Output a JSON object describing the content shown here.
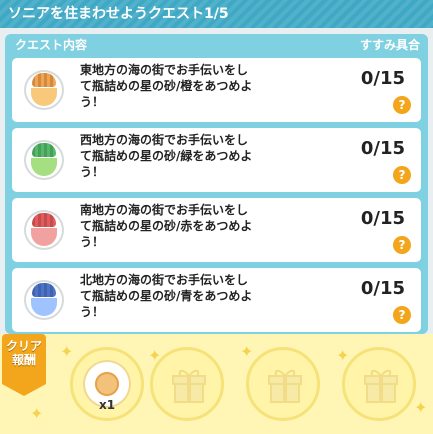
{
  "title": "ソニアを住まわせようクエスト1/5",
  "panel": {
    "header_left": "クエスト内容",
    "header_right": "すすみ具合"
  },
  "quests": [
    {
      "text": "東地方の海の街でお手伝いをし\nて瓶詰めの星の砂/橙をあつめよ\nう！",
      "progress": "0/15",
      "cap_color": "#f4a34f",
      "sand_color": "#f8c97b",
      "help": "?"
    },
    {
      "text": "西地方の海の街でお手伝いをし\nて瓶詰めの星の砂/緑をあつめよ\nう！",
      "progress": "0/15",
      "cap_color": "#55b96a",
      "sand_color": "#a6de82",
      "help": "?"
    },
    {
      "text": "南地方の海の街でお手伝いをし\nて瓶詰めの星の砂/赤をあつめよ\nう！",
      "progress": "0/15",
      "cap_color": "#e35b5b",
      "sand_color": "#f2a1a1",
      "help": "?"
    },
    {
      "text": "北地方の海の街でお手伝いをし\nて瓶詰めの星の砂/青をあつめよ\nう！",
      "progress": "0/15",
      "cap_color": "#4c74c9",
      "sand_color": "#9ec3ff",
      "help": "?"
    }
  ],
  "reward": {
    "badge": "クリア\n報酬",
    "first_qty": "x1"
  }
}
